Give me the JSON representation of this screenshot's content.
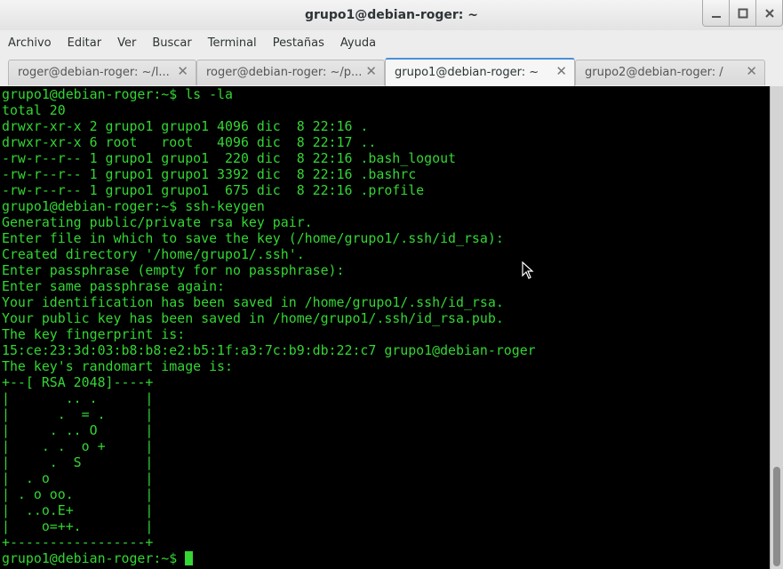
{
  "window": {
    "title": "grupo1@debian-roger: ~",
    "minimize_symbol": "_",
    "maximize_symbol": "□",
    "close_symbol": "×"
  },
  "menu": {
    "items": [
      {
        "label": "Archivo"
      },
      {
        "label": "Editar"
      },
      {
        "label": "Ver"
      },
      {
        "label": "Buscar"
      },
      {
        "label": "Terminal"
      },
      {
        "label": "Pestañas"
      },
      {
        "label": "Ayuda"
      }
    ]
  },
  "tabs": [
    {
      "label": "roger@debian-roger: ~/l...",
      "close": "✕",
      "active": false
    },
    {
      "label": "roger@debian-roger: ~/p...",
      "close": "✕",
      "active": false
    },
    {
      "label": "grupo1@debian-roger: ~",
      "close": "✕",
      "active": true
    },
    {
      "label": "grupo2@debian-roger: /",
      "close": "✕",
      "active": false
    }
  ],
  "terminal": {
    "lines": [
      "grupo1@debian-roger:~$ ls -la",
      "total 20",
      "drwxr-xr-x 2 grupo1 grupo1 4096 dic  8 22:16 .",
      "drwxr-xr-x 6 root   root   4096 dic  8 22:17 ..",
      "-rw-r--r-- 1 grupo1 grupo1  220 dic  8 22:16 .bash_logout",
      "-rw-r--r-- 1 grupo1 grupo1 3392 dic  8 22:16 .bashrc",
      "-rw-r--r-- 1 grupo1 grupo1  675 dic  8 22:16 .profile",
      "grupo1@debian-roger:~$ ssh-keygen",
      "Generating public/private rsa key pair.",
      "Enter file in which to save the key (/home/grupo1/.ssh/id_rsa):",
      "Created directory '/home/grupo1/.ssh'.",
      "Enter passphrase (empty for no passphrase):",
      "Enter same passphrase again:",
      "Your identification has been saved in /home/grupo1/.ssh/id_rsa.",
      "Your public key has been saved in /home/grupo1/.ssh/id_rsa.pub.",
      "The key fingerprint is:",
      "15:ce:23:3d:03:b8:b8:e2:b5:1f:a3:7c:b9:db:22:c7 grupo1@debian-roger",
      "The key's randomart image is:",
      "+--[ RSA 2048]----+",
      "|       .. .      |",
      "|      .  = .     |",
      "|     . .. O      |",
      "|    . .  o +     |",
      "|     .  S        |",
      "|  . o            |",
      "| . o oo.         |",
      "|  ..o.E+         |",
      "|    o=++.        |",
      "+-----------------+"
    ],
    "prompt": "grupo1@debian-roger:~$ "
  },
  "colors": {
    "terminal_fg": "#33d633",
    "terminal_bg": "#000000",
    "active_tab_accent": "#4a90d9"
  },
  "icons": {
    "minimize": "minimize-icon",
    "maximize": "maximize-icon",
    "close": "close-icon",
    "tab_close": "close-icon",
    "pointer": "mouse-pointer-icon"
  }
}
